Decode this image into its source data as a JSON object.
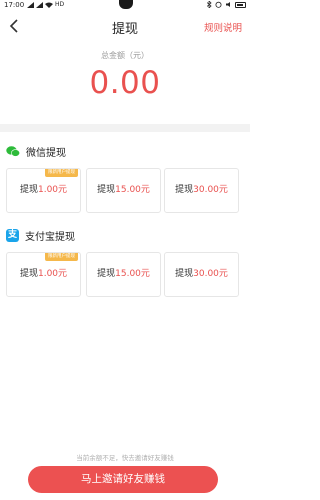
{
  "status_bar": {
    "time": "17:00",
    "network": "HD"
  },
  "nav": {
    "title": "提现",
    "rules_label": "规则说明"
  },
  "balance": {
    "label": "总金额（元）",
    "value": "0.00"
  },
  "wechat": {
    "title": "微信提现",
    "options": [
      {
        "prefix": "提现",
        "amount": "1.00元",
        "tag": "限新用户提现"
      },
      {
        "prefix": "提现",
        "amount": "15.00元"
      },
      {
        "prefix": "提现",
        "amount": "30.00元"
      }
    ]
  },
  "alipay": {
    "title": "支付宝提现",
    "icon_text": "支",
    "options": [
      {
        "prefix": "提现",
        "amount": "1.00元",
        "tag": "限新用户提现"
      },
      {
        "prefix": "提现",
        "amount": "15.00元"
      },
      {
        "prefix": "提现",
        "amount": "30.00元"
      }
    ]
  },
  "footer": {
    "tip": "当前余额不足，快去邀请好友赚钱",
    "invite_button": "马上邀请好友赚钱"
  },
  "colors": {
    "accent": "#e9514f",
    "wechat_green": "#2dbb3a",
    "alipay_blue": "#1aa4ea",
    "tag_orange": "#f5b84b"
  }
}
